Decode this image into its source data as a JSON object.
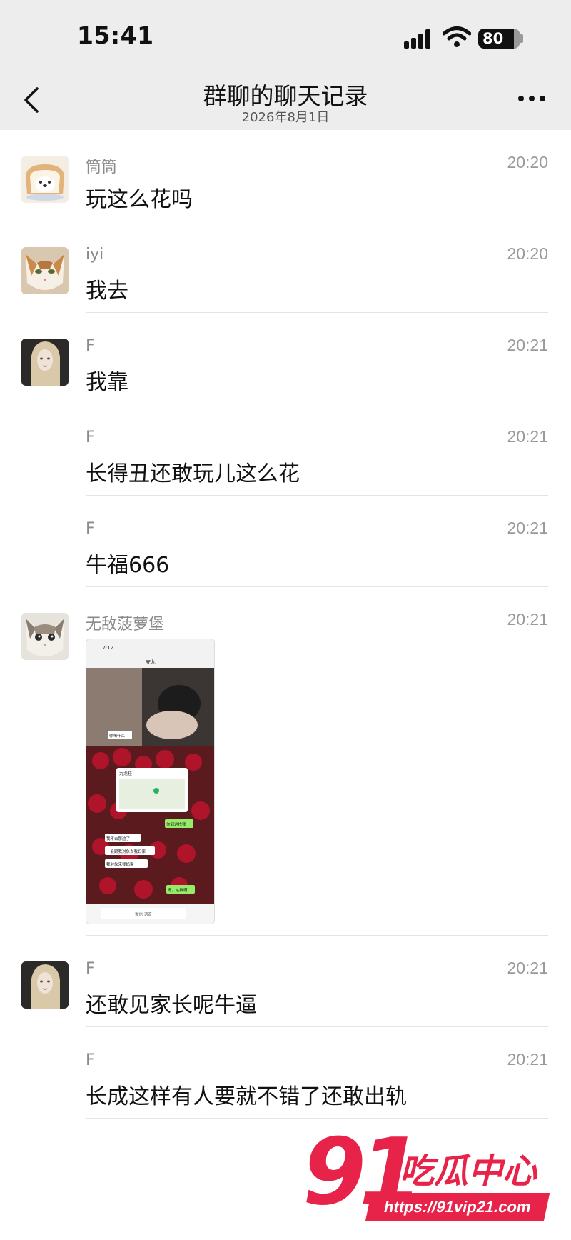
{
  "status_bar": {
    "time": "15:41",
    "battery": "80"
  },
  "nav": {
    "title": "群聊的聊天记录",
    "subtitle": "2026年8月1日"
  },
  "messages": [
    {
      "name": "筒筒",
      "time": "20:20",
      "text": "玩这么花吗",
      "avatar": "bread-dog-avatar"
    },
    {
      "name": "iyi",
      "time": "20:20",
      "text": "我去",
      "avatar": "cat-avatar"
    },
    {
      "name": "F",
      "time": "20:21",
      "text": "我靠",
      "avatar": "blonde-girl-avatar"
    },
    {
      "name": "F",
      "time": "20:21",
      "text": "长得丑还敢玩儿这么花"
    },
    {
      "name": "F",
      "time": "20:21",
      "text": "牛福666"
    },
    {
      "name": "无敌菠萝堡",
      "time": "20:21",
      "image": "chat-screenshot",
      "avatar": "kitten-avatar"
    },
    {
      "name": "F",
      "time": "20:21",
      "text": "还敢见家长呢牛逼",
      "avatar": "blonde-girl-avatar"
    },
    {
      "name": "F",
      "time": "20:21",
      "text": "长成这样有人要就不错了还敢出轨"
    }
  ],
  "screenshot": {
    "time": "17:12",
    "title": "安九",
    "bubbles": [
      "你喝什么",
      "九龙桂",
      "你到这找我",
      "我不去那边了",
      "一会跟我对象去我妈家",
      "我对象来我妈家",
      "嗯，这样啊"
    ],
    "input_placeholder": "微信 语音"
  },
  "watermark": {
    "logo": "91",
    "name": "吃瓜中心",
    "url": "https://91vip21.com"
  },
  "colors": {
    "accent": "#e8234a",
    "nav_bg": "#ededed",
    "bubble_green": "#95ec69"
  }
}
